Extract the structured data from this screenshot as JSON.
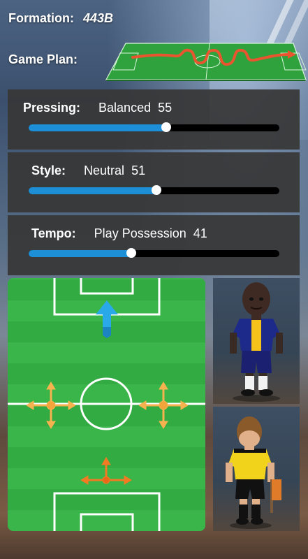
{
  "formation": {
    "label": "Formation:",
    "value": "443B"
  },
  "game_plan": {
    "label": "Game Plan:"
  },
  "tactics": [
    {
      "label": "Pressing:",
      "value_text": "Balanced",
      "value": 55
    },
    {
      "label": "Style:",
      "value_text": "Neutral",
      "value": 51
    },
    {
      "label": "Tempo:",
      "value_text": "Play Possession",
      "value": 41
    }
  ],
  "colors": {
    "slider_fill": "#1d8fd6",
    "pitch_green": "#39b54a",
    "arrow_blue": "#29a9e8",
    "arrow_orange": "#f07b22",
    "arrow_light_orange": "#f6b24e",
    "plan_arrow": "#e8552e"
  },
  "icons": {
    "forward_arrow": "up-arrow-icon",
    "move_arrows": "four-way-arrow-icon",
    "plan_route": "zigzag-arrow-icon"
  },
  "players": [
    {
      "kit": "navy-yellow",
      "role": "player"
    },
    {
      "kit": "yellow-black",
      "role": "referee"
    }
  ]
}
